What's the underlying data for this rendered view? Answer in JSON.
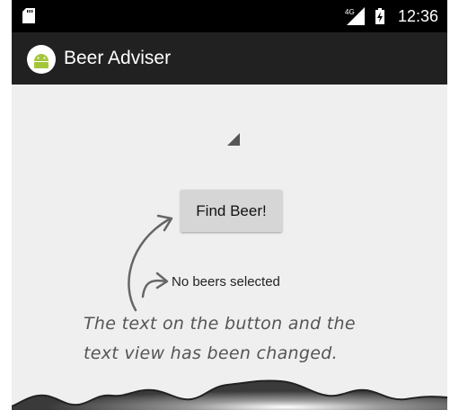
{
  "status_bar": {
    "network_label": "4G",
    "clock": "12:36"
  },
  "app_bar": {
    "title": "Beer Adviser",
    "icon": "android-icon"
  },
  "main": {
    "button_label": "Find Beer!",
    "result_text": "No beers selected"
  },
  "annotation": {
    "line1": "The text on the button and the",
    "line2": "text view has been changed."
  },
  "colors": {
    "status_bar": "#000000",
    "app_bar": "#212121",
    "background": "#efefef",
    "button": "#d6d6d6",
    "android_green": "#a4c639"
  }
}
